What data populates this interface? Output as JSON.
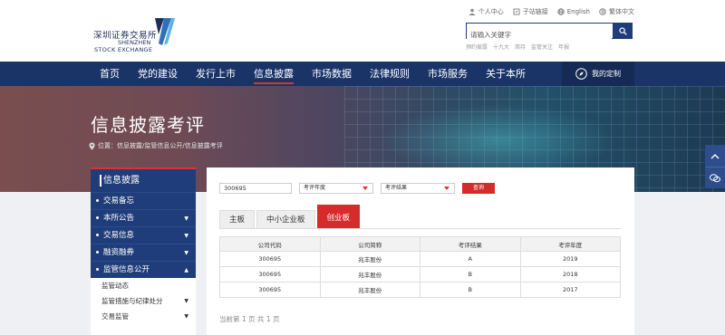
{
  "logo": {
    "cn": "深圳证券交易所",
    "en_line1": "SHENZHEN",
    "en_line2": "STOCK EXCHANGE"
  },
  "toplinks": [
    {
      "label": "个人中心",
      "icon": "user-icon"
    },
    {
      "label": "子站链接",
      "icon": "link-icon"
    },
    {
      "label": "English",
      "icon": "globe-icon"
    },
    {
      "label": "繁体中文",
      "icon": "language-icon"
    }
  ],
  "search": {
    "placeholder": "请输入关键字",
    "hotwords": [
      "预约披露",
      "十九大",
      "简持",
      "监管关注",
      "年报"
    ]
  },
  "nav": {
    "items": [
      "首页",
      "党的建设",
      "发行上市",
      "信息披露",
      "市场数据",
      "法律规则",
      "市场服务",
      "关于本所"
    ],
    "active_index": 3,
    "custom_label": "我的定制"
  },
  "banner": {
    "title": "信息披露考评",
    "breadcrumb": "位置：信息披露/监管信息公开/信息披露考评"
  },
  "sidebar": {
    "header": "信息披露",
    "items": [
      {
        "label": "交易备忘",
        "caret": ""
      },
      {
        "label": "本所公告",
        "caret": "▼"
      },
      {
        "label": "交易信息",
        "caret": "▼"
      },
      {
        "label": "融资融券",
        "caret": "▼"
      },
      {
        "label": "监管信息公开",
        "caret": "▲"
      }
    ],
    "subitems": [
      {
        "label": "监管动态",
        "caret": ""
      },
      {
        "label": "监管措施与纪律处分",
        "caret": "▼"
      },
      {
        "label": "交易监管",
        "caret": "▼"
      }
    ]
  },
  "filters": {
    "code_value": "300695",
    "year_placeholder": "考评年度",
    "result_placeholder": "考评结果",
    "query_label": "查询"
  },
  "tabs": {
    "items": [
      "主板",
      "中小企业板",
      "创业板"
    ],
    "active_index": 2
  },
  "table": {
    "headers": [
      "公司代码",
      "公司简称",
      "考评结果",
      "考评年度"
    ],
    "rows": [
      [
        "300695",
        "兆丰股份",
        "A",
        "2019"
      ],
      [
        "300695",
        "兆丰股份",
        "B",
        "2018"
      ],
      [
        "300695",
        "兆丰股份",
        "B",
        "2017"
      ]
    ]
  },
  "pager": "当前第 1 页   共 1 页",
  "colors": {
    "navy": "#1a3468",
    "accent_red": "#d62b2b",
    "sidebar_blue": "#1f3d7a"
  }
}
